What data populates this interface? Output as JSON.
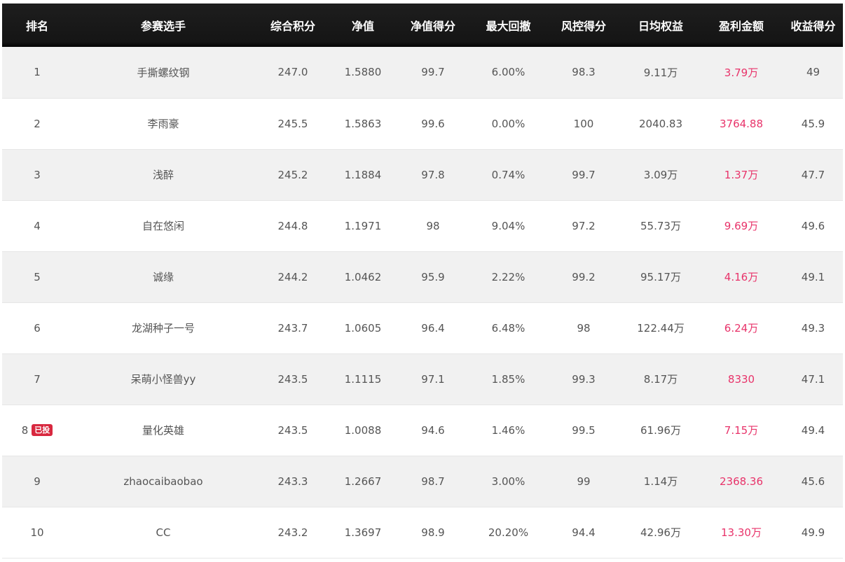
{
  "table": {
    "headers": [
      "排名",
      "参赛选手",
      "综合积分",
      "净值",
      "净值得分",
      "最大回撤",
      "风控得分",
      "日均权益",
      "盈利金额",
      "收益得分"
    ],
    "rows": [
      {
        "rank": "1",
        "badge": "",
        "player": "手撕螺纹钢",
        "score": "247.0",
        "nav": "1.5880",
        "nav_score": "99.7",
        "max_drawdown": "6.00%",
        "risk_score": "98.3",
        "avg_equity": "9.11万",
        "profit": "3.79万",
        "return_score": "49"
      },
      {
        "rank": "2",
        "badge": "",
        "player": "李雨豪",
        "score": "245.5",
        "nav": "1.5863",
        "nav_score": "99.6",
        "max_drawdown": "0.00%",
        "risk_score": "100",
        "avg_equity": "2040.83",
        "profit": "3764.88",
        "return_score": "45.9"
      },
      {
        "rank": "3",
        "badge": "",
        "player": "浅醉",
        "score": "245.2",
        "nav": "1.1884",
        "nav_score": "97.8",
        "max_drawdown": "0.74%",
        "risk_score": "99.7",
        "avg_equity": "3.09万",
        "profit": "1.37万",
        "return_score": "47.7"
      },
      {
        "rank": "4",
        "badge": "",
        "player": "自在悠闲",
        "score": "244.8",
        "nav": "1.1971",
        "nav_score": "98",
        "max_drawdown": "9.04%",
        "risk_score": "97.2",
        "avg_equity": "55.73万",
        "profit": "9.69万",
        "return_score": "49.6"
      },
      {
        "rank": "5",
        "badge": "",
        "player": "诚缘",
        "score": "244.2",
        "nav": "1.0462",
        "nav_score": "95.9",
        "max_drawdown": "2.22%",
        "risk_score": "99.2",
        "avg_equity": "95.17万",
        "profit": "4.16万",
        "return_score": "49.1"
      },
      {
        "rank": "6",
        "badge": "",
        "player": "龙湖种子一号",
        "score": "243.7",
        "nav": "1.0605",
        "nav_score": "96.4",
        "max_drawdown": "6.48%",
        "risk_score": "98",
        "avg_equity": "122.44万",
        "profit": "6.24万",
        "return_score": "49.3"
      },
      {
        "rank": "7",
        "badge": "",
        "player": "呆萌小怪兽yy",
        "score": "243.5",
        "nav": "1.1115",
        "nav_score": "97.1",
        "max_drawdown": "1.85%",
        "risk_score": "99.3",
        "avg_equity": "8.17万",
        "profit": "8330",
        "return_score": "47.1"
      },
      {
        "rank": "8",
        "badge": "已投",
        "player": "量化英雄",
        "score": "243.5",
        "nav": "1.0088",
        "nav_score": "94.6",
        "max_drawdown": "1.46%",
        "risk_score": "99.5",
        "avg_equity": "61.96万",
        "profit": "7.15万",
        "return_score": "49.4"
      },
      {
        "rank": "9",
        "badge": "",
        "player": "zhaocaibaobao",
        "score": "243.3",
        "nav": "1.2667",
        "nav_score": "98.7",
        "max_drawdown": "3.00%",
        "risk_score": "99",
        "avg_equity": "1.14万",
        "profit": "2368.36",
        "return_score": "45.6"
      },
      {
        "rank": "10",
        "badge": "",
        "player": "CC",
        "score": "243.2",
        "nav": "1.3697",
        "nav_score": "98.9",
        "max_drawdown": "20.20%",
        "risk_score": "94.4",
        "avg_equity": "42.96万",
        "profit": "13.30万",
        "return_score": "49.9"
      }
    ]
  },
  "colors": {
    "header_bg": "#151515",
    "odd_row_bg": "#f1f1f1",
    "even_row_bg": "#ffffff",
    "profit_text": "#e8336a",
    "badge_bg": "#d8283f"
  }
}
